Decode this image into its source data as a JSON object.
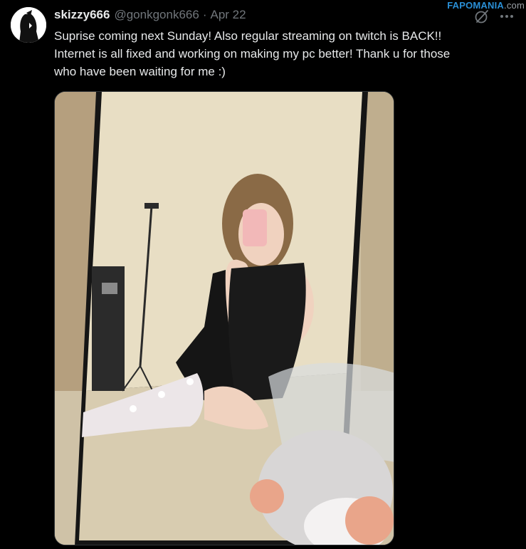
{
  "watermark": {
    "main": "FAPOMANIA",
    "tld": ".com"
  },
  "author": {
    "display_name": "skizzy666",
    "handle": "@gonkgonk666",
    "separator": "·",
    "date": "Apr 22"
  },
  "tweet": {
    "text": "Suprise coming next Sunday! Also regular streaming on twitch is BACK!!\nInternet is all fixed and working on making my pc better! Thank u for those\nwho have been waiting for me :)"
  },
  "icons": {
    "grok": "grok-icon",
    "more": "more-icon",
    "avatar": "avatar"
  },
  "colors": {
    "background": "#000000",
    "text": "#e7e9ea",
    "muted": "#71767b",
    "watermark_accent": "#2a8fd6"
  }
}
